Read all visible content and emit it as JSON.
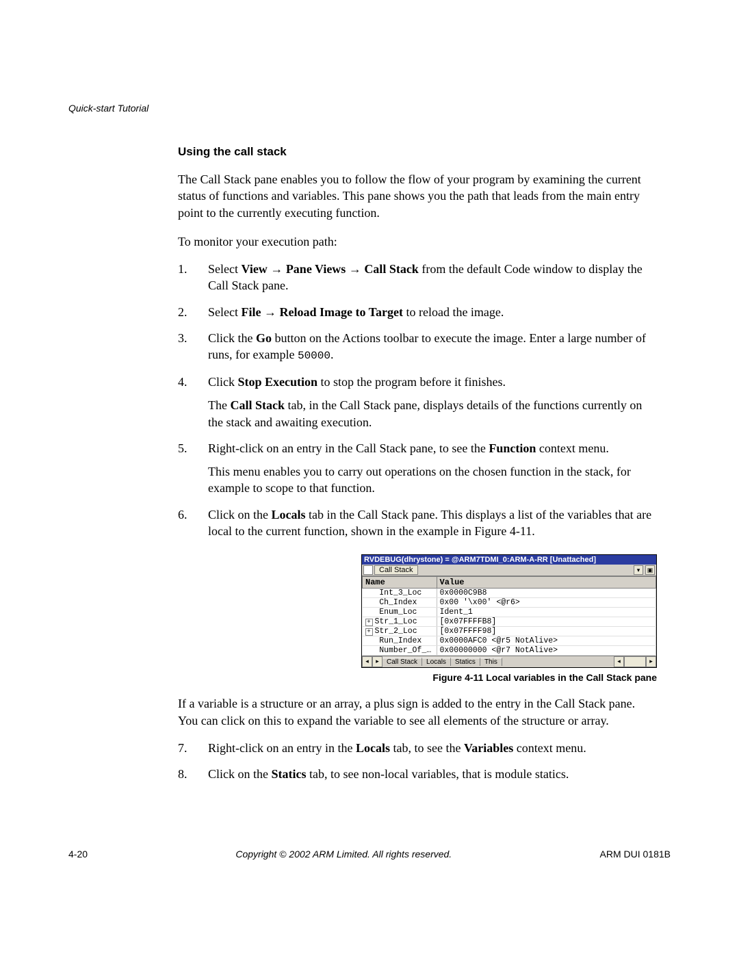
{
  "running_head": "Quick-start Tutorial",
  "section_title": "Using the call stack",
  "intro_para": "The Call Stack pane enables you to follow the flow of your program by examining the current status of functions and variables. This pane shows you the path that leads from the main entry point to the currently executing function.",
  "intro_para2": "To monitor your execution path:",
  "steps": {
    "s1_a": "Select ",
    "s1_view": "View",
    "s1_arrow1": " → ",
    "s1_paneviews": "Pane Views",
    "s1_arrow2": " → ",
    "s1_callstack": "Call Stack",
    "s1_b": " from the default Code window to display the Call Stack pane.",
    "s2_a": "Select ",
    "s2_file": "File",
    "s2_arrow": " → ",
    "s2_reload": "Reload Image to Target",
    "s2_b": " to reload the image.",
    "s3_a": "Click the ",
    "s3_go": "Go",
    "s3_b": " button on the Actions toolbar to execute the image. Enter a large number of runs, for example ",
    "s3_num": "50000",
    "s3_c": ".",
    "s4_a": "Click ",
    "s4_stop": "Stop Execution",
    "s4_b": " to stop the program before it finishes.",
    "s4_p2a": "The ",
    "s4_p2b": "Call Stack",
    "s4_p2c": " tab, in the Call Stack pane, displays details of the functions currently on the stack and awaiting execution.",
    "s5_a": "Right-click on an entry in the Call Stack pane, to see the ",
    "s5_func": "Function",
    "s5_b": " context menu.",
    "s5_p2": "This menu enables you to carry out operations on the chosen function in the stack, for example to scope to that function.",
    "s6_a": "Click on the ",
    "s6_locals": "Locals",
    "s6_b": " tab in the Call Stack pane. This displays a list of the variables that are local to the current function, shown in the example in Figure 4-11.",
    "s7_a": "Right-click on an entry in the ",
    "s7_locals": "Locals",
    "s7_b": " tab, to see the ",
    "s7_vars": "Variables",
    "s7_c": " context menu.",
    "s8_a": "Click on the ",
    "s8_statics": "Statics",
    "s8_b": " tab, to see non-local variables, that is module statics."
  },
  "after_fig": "If a variable is a structure or an array, a plus sign is added to the entry in the Call Stack pane. You can click on this to expand the variable to see all elements of the structure or array.",
  "pane": {
    "titlebar": "RVDEBUG(dhrystone) = @ARM7TDMI_0:ARM-A-RR [Unattached]",
    "tab_label": "Call Stack",
    "headers": {
      "name": "Name",
      "value": "Value"
    },
    "rows": [
      {
        "exp": "",
        "name": "Int_3_Loc",
        "value": "0x0000C9B8"
      },
      {
        "exp": "",
        "name": "Ch_Index",
        "value": "0x00 '\\x00' <@r6>"
      },
      {
        "exp": "",
        "name": "Enum_Loc",
        "value": "Ident_1"
      },
      {
        "exp": "+",
        "name": "Str_1_Loc",
        "value": "[0x07FFFFB8]"
      },
      {
        "exp": "+",
        "name": "Str_2_Loc",
        "value": "[0x07FFFF98]"
      },
      {
        "exp": "",
        "name": "Run_Index",
        "value": "0x0000AFC0 <@r5 NotAlive>"
      },
      {
        "exp": "",
        "name": "Number_Of_…",
        "value": "0x00000000 <@r7 NotAlive>"
      }
    ],
    "bottom_tabs": [
      "Call Stack",
      "Locals",
      "Statics",
      "This"
    ]
  },
  "chart_data": {
    "type": "table",
    "title": "Local variables in the Call Stack pane",
    "columns": [
      "Name",
      "Value"
    ],
    "rows": [
      [
        "Int_3_Loc",
        "0x0000C9B8"
      ],
      [
        "Ch_Index",
        "0x00 '\\x00' <@r6>"
      ],
      [
        "Enum_Loc",
        "Ident_1"
      ],
      [
        "Str_1_Loc",
        "[0x07FFFFB8]"
      ],
      [
        "Str_2_Loc",
        "[0x07FFFF98]"
      ],
      [
        "Run_Index",
        "0x0000AFC0 <@r5 NotAlive>"
      ],
      [
        "Number_Of_…",
        "0x00000000 <@r7 NotAlive>"
      ]
    ]
  },
  "figure_caption": "Figure 4-11 Local variables in the Call Stack pane",
  "footer": {
    "left": "4-20",
    "center": "Copyright © 2002 ARM Limited. All rights reserved.",
    "right": "ARM DUI 0181B"
  }
}
